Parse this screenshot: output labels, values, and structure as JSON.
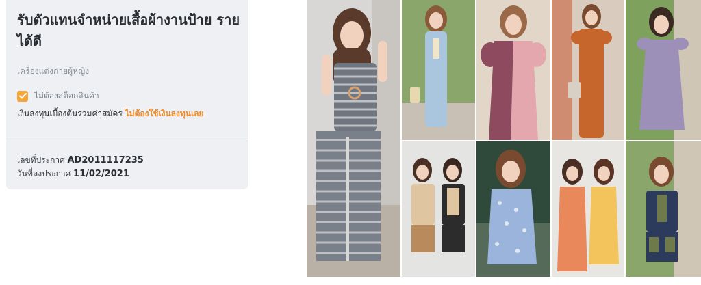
{
  "listing": {
    "title": "รับตัวแทนจำหน่ายเสื้อผ้างานป้าย รายได้ดี",
    "category": "เครื่องแต่งกายผู้หญิง",
    "no_stock_label": "ไม่ต้องสต็อกสินค้า",
    "investment_label": "เงินลงทุนเบื้องต้นรวมค่าสมัคร",
    "investment_value": "ไม่ต้องใช้เงินลงทุนเลย",
    "ad_number_label": "เลขที่ประกาศ",
    "ad_number": "AD2011117235",
    "post_date_label": "วันที่ลงประกาศ",
    "post_date": "11/02/2021"
  },
  "gallery": {
    "photos": [
      "model-gingham-peplum-set",
      "model-blue-jumpsuit",
      "model-pink-panel-dress",
      "model-orange-jumpsuit",
      "model-lavender-dress",
      "models-brown-black-shorts-sets",
      "model-blue-floral-romper",
      "models-orange-yellow-blouses",
      "model-navy-olive-set"
    ]
  },
  "colors": {
    "accent": "#f08a24",
    "checkbox": "#f5a53a",
    "card_bg": "#eef0f3"
  }
}
